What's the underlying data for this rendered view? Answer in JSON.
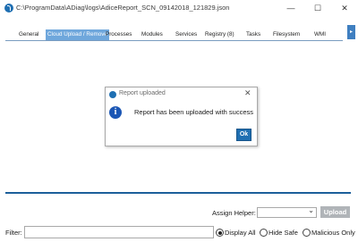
{
  "window": {
    "title": "C:\\ProgramData\\ADiag\\logs\\AdiceReport_SCN_09142018_121829.json",
    "controls": {
      "minimize": "—",
      "maximize": "☐",
      "close": "✕"
    }
  },
  "tabs": [
    {
      "label": "General",
      "active": false
    },
    {
      "label": "Cloud Upload / Remove",
      "active": true
    },
    {
      "label": "Processes",
      "active": false
    },
    {
      "label": "Modules",
      "active": false
    },
    {
      "label": "Services",
      "active": false
    },
    {
      "label": "Registry (8)",
      "active": false
    },
    {
      "label": "Tasks",
      "active": false
    },
    {
      "label": "Filesystem",
      "active": false
    },
    {
      "label": "WMI",
      "active": false
    }
  ],
  "tab_scroll_glyph": "▸",
  "dialog": {
    "title": "Report uploaded",
    "close_glyph": "✕",
    "info_glyph": "i",
    "message": "Report has been uploaded with success",
    "ok_label": "Ok"
  },
  "bottom": {
    "assign_label": "Assign Helper:",
    "assign_value": "",
    "assign_chevron": "⌄",
    "upload_label": "Upload",
    "filter_label": "Filter:",
    "filter_value": "",
    "radios": [
      {
        "label": "Display All",
        "checked": true
      },
      {
        "label": "Hide Safe",
        "checked": false
      },
      {
        "label": "Malicious Only",
        "checked": false
      }
    ]
  },
  "colors": {
    "accent": "#1f6fb2",
    "active_tab": "#6fa7dc",
    "upload_disabled": "#b0b4b8"
  }
}
